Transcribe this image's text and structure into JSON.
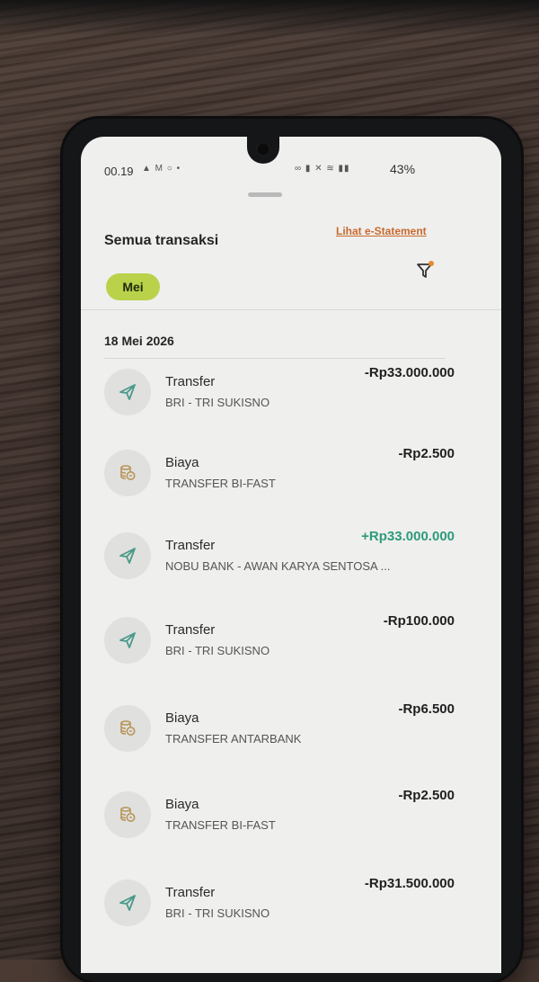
{
  "status_bar": {
    "time": "00.19",
    "left_icons": "▲ M ○ •",
    "right_icons": "∞ ▮ ✕ ≋ ▮▮",
    "battery": "43%"
  },
  "header": {
    "title": "Semua transaksi",
    "estatement_link": "Lihat e-Statement"
  },
  "filters": {
    "month_chip": "Mei"
  },
  "date_header": "18 Mei 2026",
  "colors": {
    "accent_chip": "#b9d24a",
    "link": "#c86a2f",
    "credit": "#2e9a7c",
    "icon_stroke": "#4a9a8a",
    "fee_icon": "#b8955a"
  },
  "transactions": [
    {
      "type": "Transfer",
      "description": "BRI - TRI SUKISNO",
      "amount": "-Rp33.000.000",
      "icon": "send-icon"
    },
    {
      "type": "Biaya",
      "description": "TRANSFER BI-FAST",
      "amount": "-Rp2.500",
      "icon": "coins-icon"
    },
    {
      "type": "Transfer",
      "description": "NOBU BANK - AWAN KARYA SENTOSA ...",
      "amount": "+Rp33.000.000",
      "icon": "send-icon"
    },
    {
      "type": "Transfer",
      "description": "BRI - TRI SUKISNO",
      "amount": "-Rp100.000",
      "icon": "send-icon"
    },
    {
      "type": "Biaya",
      "description": "TRANSFER ANTARBANK",
      "amount": "-Rp6.500",
      "icon": "coins-icon"
    },
    {
      "type": "Biaya",
      "description": "TRANSFER BI-FAST",
      "amount": "-Rp2.500",
      "icon": "coins-icon"
    },
    {
      "type": "Transfer",
      "description": "BRI - TRI SUKISNO",
      "amount": "-Rp31.500.000",
      "icon": "send-icon"
    }
  ]
}
